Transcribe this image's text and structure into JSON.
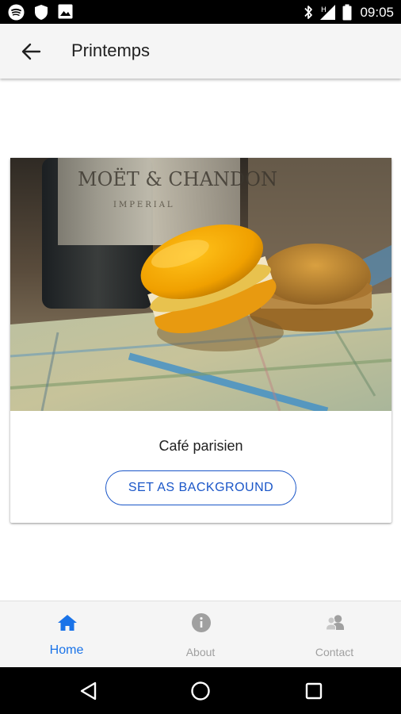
{
  "status_bar": {
    "time": "09:05",
    "left_icons": [
      "spotify-icon",
      "shield-icon",
      "image-icon"
    ],
    "right_icons": [
      "bluetooth-icon",
      "signal-h-icon",
      "battery-icon"
    ]
  },
  "app_bar": {
    "back_icon": "arrow-back-icon",
    "title": "Printemps"
  },
  "card": {
    "image_icon": "macarons-photo",
    "title": "Café parisien",
    "button_label": "SET AS BACKGROUND"
  },
  "bottom_nav": {
    "items": [
      {
        "label": "Home",
        "icon": "home-icon",
        "active": true
      },
      {
        "label": "About",
        "icon": "info-icon",
        "active": false
      },
      {
        "label": "Contact",
        "icon": "contact-icon",
        "active": false
      }
    ]
  },
  "system_nav": {
    "buttons": [
      "back-triangle-icon",
      "home-circle-icon",
      "recents-square-icon"
    ]
  },
  "colors": {
    "accent": "#1a73e8",
    "button_accent": "#1a56c8",
    "inactive": "#a0a0a0",
    "app_bar_bg": "#f5f5f5"
  }
}
